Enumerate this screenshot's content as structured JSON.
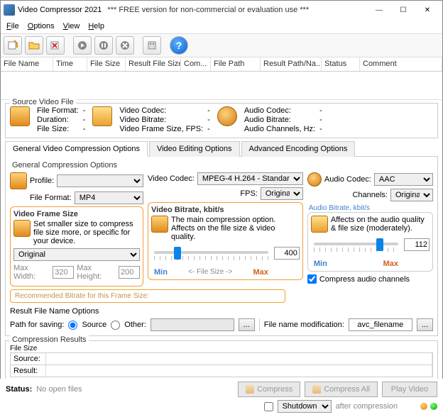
{
  "window": {
    "title": "Video Compressor 2021",
    "free_notice": "*** FREE version for non-commercial or evaluation use ***"
  },
  "menu": {
    "file": "File",
    "options": "Options",
    "view": "View",
    "help": "Help"
  },
  "grid_columns": {
    "filename": "File Name",
    "time": "Time",
    "filesize": "File Size",
    "result": "Result File Size",
    "com": "Com...",
    "filepath": "File Path",
    "resultpath": "Result Path/Na...",
    "status": "Status",
    "comment": "Comment"
  },
  "source": {
    "group": "Source Video File",
    "file_format_l": "File Format:",
    "file_format_v": "-",
    "duration_l": "Duration:",
    "duration_v": "-",
    "file_size_l": "File Size:",
    "file_size_v": "-",
    "vcodec_l": "Video Codec:",
    "vcodec_v": "-",
    "vbitrate_l": "Video Bitrate:",
    "vbitrate_v": "-",
    "vframe_l": "Video Frame Size, FPS:",
    "vframe_v": "-",
    "acodec_l": "Audio Codec:",
    "acodec_v": "-",
    "abitrate_l": "Audio Bitrate:",
    "abitrate_v": "-",
    "achan_l": "Audio Channels, Hz:",
    "achan_v": "-"
  },
  "tabs": {
    "general": "General Video Compression Options",
    "editing": "Video Editing Options",
    "advanced": "Advanced Encoding Options"
  },
  "gco": {
    "group": "General Compression Options",
    "profile_l": "Profile:",
    "format_l": "File Format:",
    "format_v": "MP4",
    "frame_title": "Video Frame Size",
    "frame_desc": "Set smaller size to compress file size more, or specific for your device.",
    "frame_sel": "Original",
    "maxw_l": "Max Width:",
    "maxw_v": "320",
    "maxh_l": "Max Height:",
    "maxh_v": "200",
    "rec": "Recommended Bitrate for this Frame Size:"
  },
  "vbit": {
    "vcodec_l": "Video Codec:",
    "vcodec_v": "MPEG-4 H.264 - Standar",
    "fps_l": "FPS:",
    "fps_v": "Original",
    "title": "Video Bitrate, kbit/s",
    "desc": "The main compression option. Affects on the file size & video quality.",
    "value": "400",
    "min": "Min",
    "max": "Max",
    "fsize": "<-  File Size  ->"
  },
  "aud": {
    "acodec_l": "Audio Codec:",
    "acodec_v": "AAC",
    "chan_l": "Channels:",
    "chan_v": "Original",
    "title": "Audio Bitrate, kbit/s",
    "desc": "Affects on the audio quality & file size (moderately).",
    "value": "112",
    "min": "Min",
    "max": "Max",
    "compress_chk": "Compress audio channels"
  },
  "resultname": {
    "group": "Result File Name Options",
    "path_l": "Path for saving:",
    "source": "Source",
    "other": "Other:",
    "browse": "...",
    "mod_l": "File name modification:",
    "mod_v": "avc_filename",
    "mod_btn": "..."
  },
  "results": {
    "group": "Compression Results",
    "filesize_l": "File Size",
    "source_l": "Source:",
    "result_l": "Result:"
  },
  "status": {
    "label": "Status:",
    "text": "No open files",
    "compress": "Compress",
    "compress_all": "Compress All",
    "play": "Play Video",
    "shutdown": "Shutdown",
    "after": "after compression"
  }
}
